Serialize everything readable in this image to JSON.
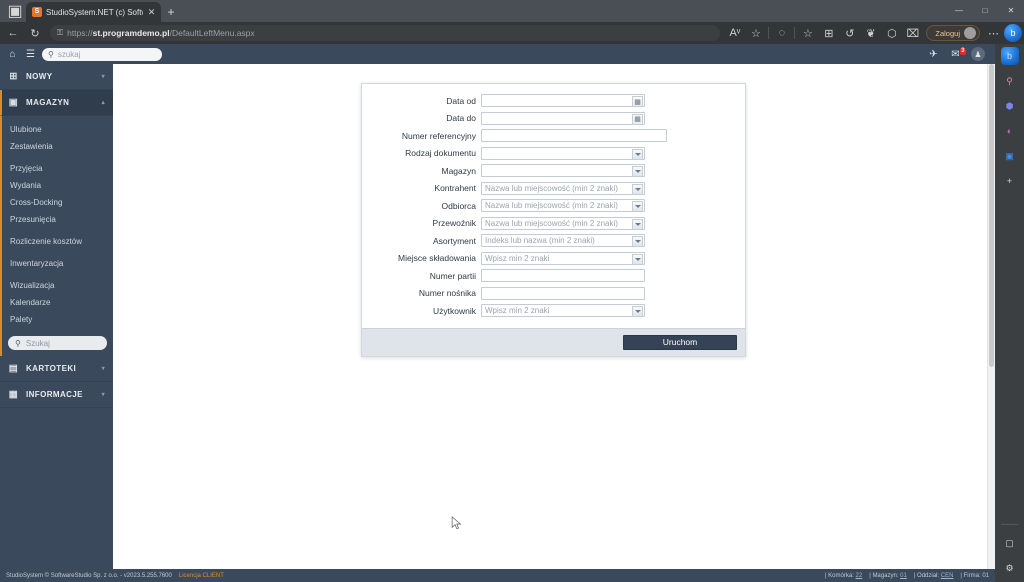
{
  "browser": {
    "name": "Microsoft Edge",
    "tab": {
      "favicon_letter": "S",
      "title": "StudioSystem.NET (c) SoftwareSt",
      "close_glyph": "✕"
    },
    "new_tab_glyph": "+",
    "tab_list_glyph": "▣",
    "window_controls": [
      "—",
      "□",
      "✕"
    ],
    "nav": {
      "back_glyph": "←",
      "forward_glyph": "→",
      "reload_glyph": "↻",
      "lock_glyph": "🔒",
      "url_prefix": "https://",
      "url_host": "st.programdemo.pl",
      "url_path": "/DefaultLeftMenu.aspx"
    },
    "toolbar_right": [
      {
        "name": "read-aloud-icon",
        "glyph": "Aᵛ"
      },
      {
        "name": "favorite-star-icon",
        "glyph": "☆"
      },
      {
        "name": "history-circle-icon",
        "glyph": "◌"
      },
      {
        "name": "favorites-add-icon",
        "glyph": "☆"
      },
      {
        "name": "collections-icon",
        "glyph": "⊞"
      },
      {
        "name": "history-icon",
        "glyph": "↺"
      },
      {
        "name": "browser-essentials-icon",
        "glyph": "❦"
      },
      {
        "name": "extensions-icon",
        "glyph": "⬡"
      },
      {
        "name": "split-screen-icon",
        "glyph": "⌧"
      }
    ],
    "signin": {
      "label": "Zaloguj"
    },
    "copilot_glyph": "b",
    "settings_more_glyph": "⋯"
  },
  "edge_sidebar": {
    "items": [
      {
        "name": "copilot-icon",
        "glyph": "b"
      },
      {
        "name": "search-icon",
        "glyph": "🔍"
      },
      {
        "name": "shopping-icon",
        "glyph": "⬢"
      },
      {
        "name": "games-icon",
        "glyph": "◔"
      },
      {
        "name": "outlook-icon",
        "glyph": "▣"
      },
      {
        "name": "add-sidebar-app-icon",
        "glyph": "+"
      }
    ],
    "bottom_items": [
      {
        "name": "browser-essentials-icon",
        "glyph": "▢"
      },
      {
        "name": "sidebar-settings-icon",
        "glyph": "⚙"
      }
    ]
  },
  "app": {
    "topbar": {
      "home_icon": "⌂",
      "menu_icon": "☰",
      "search_placeholder": "szukaj",
      "search_icon": "🔍",
      "right_icons": [
        {
          "name": "send-plane-icon",
          "glyph": "✈"
        },
        {
          "name": "mail-icon",
          "glyph": "✉",
          "badge": "3"
        },
        {
          "name": "user-avatar-icon",
          "glyph": "♟"
        }
      ]
    },
    "sidebar": {
      "groups": [
        {
          "label": "NOWY",
          "icon": "⊞",
          "icon_name": "grid-plus-icon",
          "expanded": false,
          "caret": "▾",
          "items": []
        },
        {
          "label": "MAGAZYN",
          "icon": "💾",
          "icon_name": "warehouse-icon",
          "expanded": true,
          "caret": "▴",
          "items": [
            {
              "label": "Ulubione",
              "gap_after": false
            },
            {
              "label": "Zestawienia",
              "gap_after": true
            },
            {
              "label": "Przyjęcia",
              "gap_after": false
            },
            {
              "label": "Wydania",
              "gap_after": false
            },
            {
              "label": "Cross-Docking",
              "gap_after": false
            },
            {
              "label": "Przesunięcia",
              "gap_after": true
            },
            {
              "label": "Rozliczenie kosztów",
              "gap_after": true
            },
            {
              "label": "Inwentaryzacja",
              "gap_after": true
            },
            {
              "label": "Wizualizacja",
              "gap_after": false
            },
            {
              "label": "Kalendarze",
              "gap_after": false
            },
            {
              "label": "Palety",
              "gap_after": false
            }
          ],
          "search_placeholder": "Szukaj",
          "search_icon": "🔍"
        },
        {
          "label": "KARTOTEKI",
          "icon": "▤",
          "icon_name": "cards-icon",
          "expanded": false,
          "caret": "▾",
          "items": []
        },
        {
          "label": "INFORMACJE",
          "icon": "☰",
          "icon_name": "document-icon",
          "expanded": false,
          "caret": "▾",
          "items": []
        }
      ]
    },
    "form": {
      "fields": [
        {
          "label": "Data od",
          "type": "date",
          "value": "",
          "placeholder": "",
          "name": "date-from"
        },
        {
          "label": "Data do",
          "type": "date",
          "value": "",
          "placeholder": "",
          "name": "date-to"
        },
        {
          "label": "Numer referencyjny",
          "type": "text",
          "value": "",
          "placeholder": "",
          "name": "reference-number"
        },
        {
          "label": "Rodzaj dokumentu",
          "type": "select",
          "value": "",
          "placeholder": "",
          "name": "document-type"
        },
        {
          "label": "Magazyn",
          "type": "select",
          "value": "",
          "placeholder": "",
          "name": "warehouse"
        },
        {
          "label": "Kontrahent",
          "type": "select",
          "value": "",
          "placeholder": "Nazwa lub miejscowość (min 2 znaki)",
          "name": "contractor"
        },
        {
          "label": "Odbiorca",
          "type": "select",
          "value": "",
          "placeholder": "Nazwa lub miejscowość (min 2 znaki)",
          "name": "recipient"
        },
        {
          "label": "Przewoźnik",
          "type": "select",
          "value": "",
          "placeholder": "Nazwa lub miejscowość (min 2 znaki)",
          "name": "carrier"
        },
        {
          "label": "Asortyment",
          "type": "select",
          "value": "",
          "placeholder": "Indeks lub nazwa (min 2 znaki)",
          "name": "assortment"
        },
        {
          "label": "Miejsce składowania",
          "type": "select",
          "value": "",
          "placeholder": "Wpisz min 2 znaki",
          "name": "storage-location"
        },
        {
          "label": "Numer partii",
          "type": "text",
          "value": "",
          "placeholder": "",
          "name": "batch-number"
        },
        {
          "label": "Numer nośnika",
          "type": "text",
          "value": "",
          "placeholder": "",
          "name": "carrier-number"
        },
        {
          "label": "Użytkownik",
          "type": "select",
          "value": "",
          "placeholder": "Wpisz min 2 znaki",
          "name": "user"
        }
      ],
      "submit_label": "Uruchom",
      "calendar_glyph": "▦"
    },
    "footer": {
      "copyright": "StudioSystem © SoftwareStudio Sp. z o.o. - v2023.5.255.7600",
      "license": "Licencja CLIENT",
      "status": [
        {
          "label": "Komórka:",
          "value": "22"
        },
        {
          "label": "Magazyn:",
          "value": "01"
        },
        {
          "label": "Oddział:",
          "value": "CEN"
        },
        {
          "label": "Firma:",
          "value": "01"
        }
      ]
    }
  },
  "colors": {
    "sidebar_bg": "#3a4a5c",
    "accent_orange": "#d98b2b",
    "button_dark": "#344355",
    "badge_red": "#e02b2b"
  }
}
